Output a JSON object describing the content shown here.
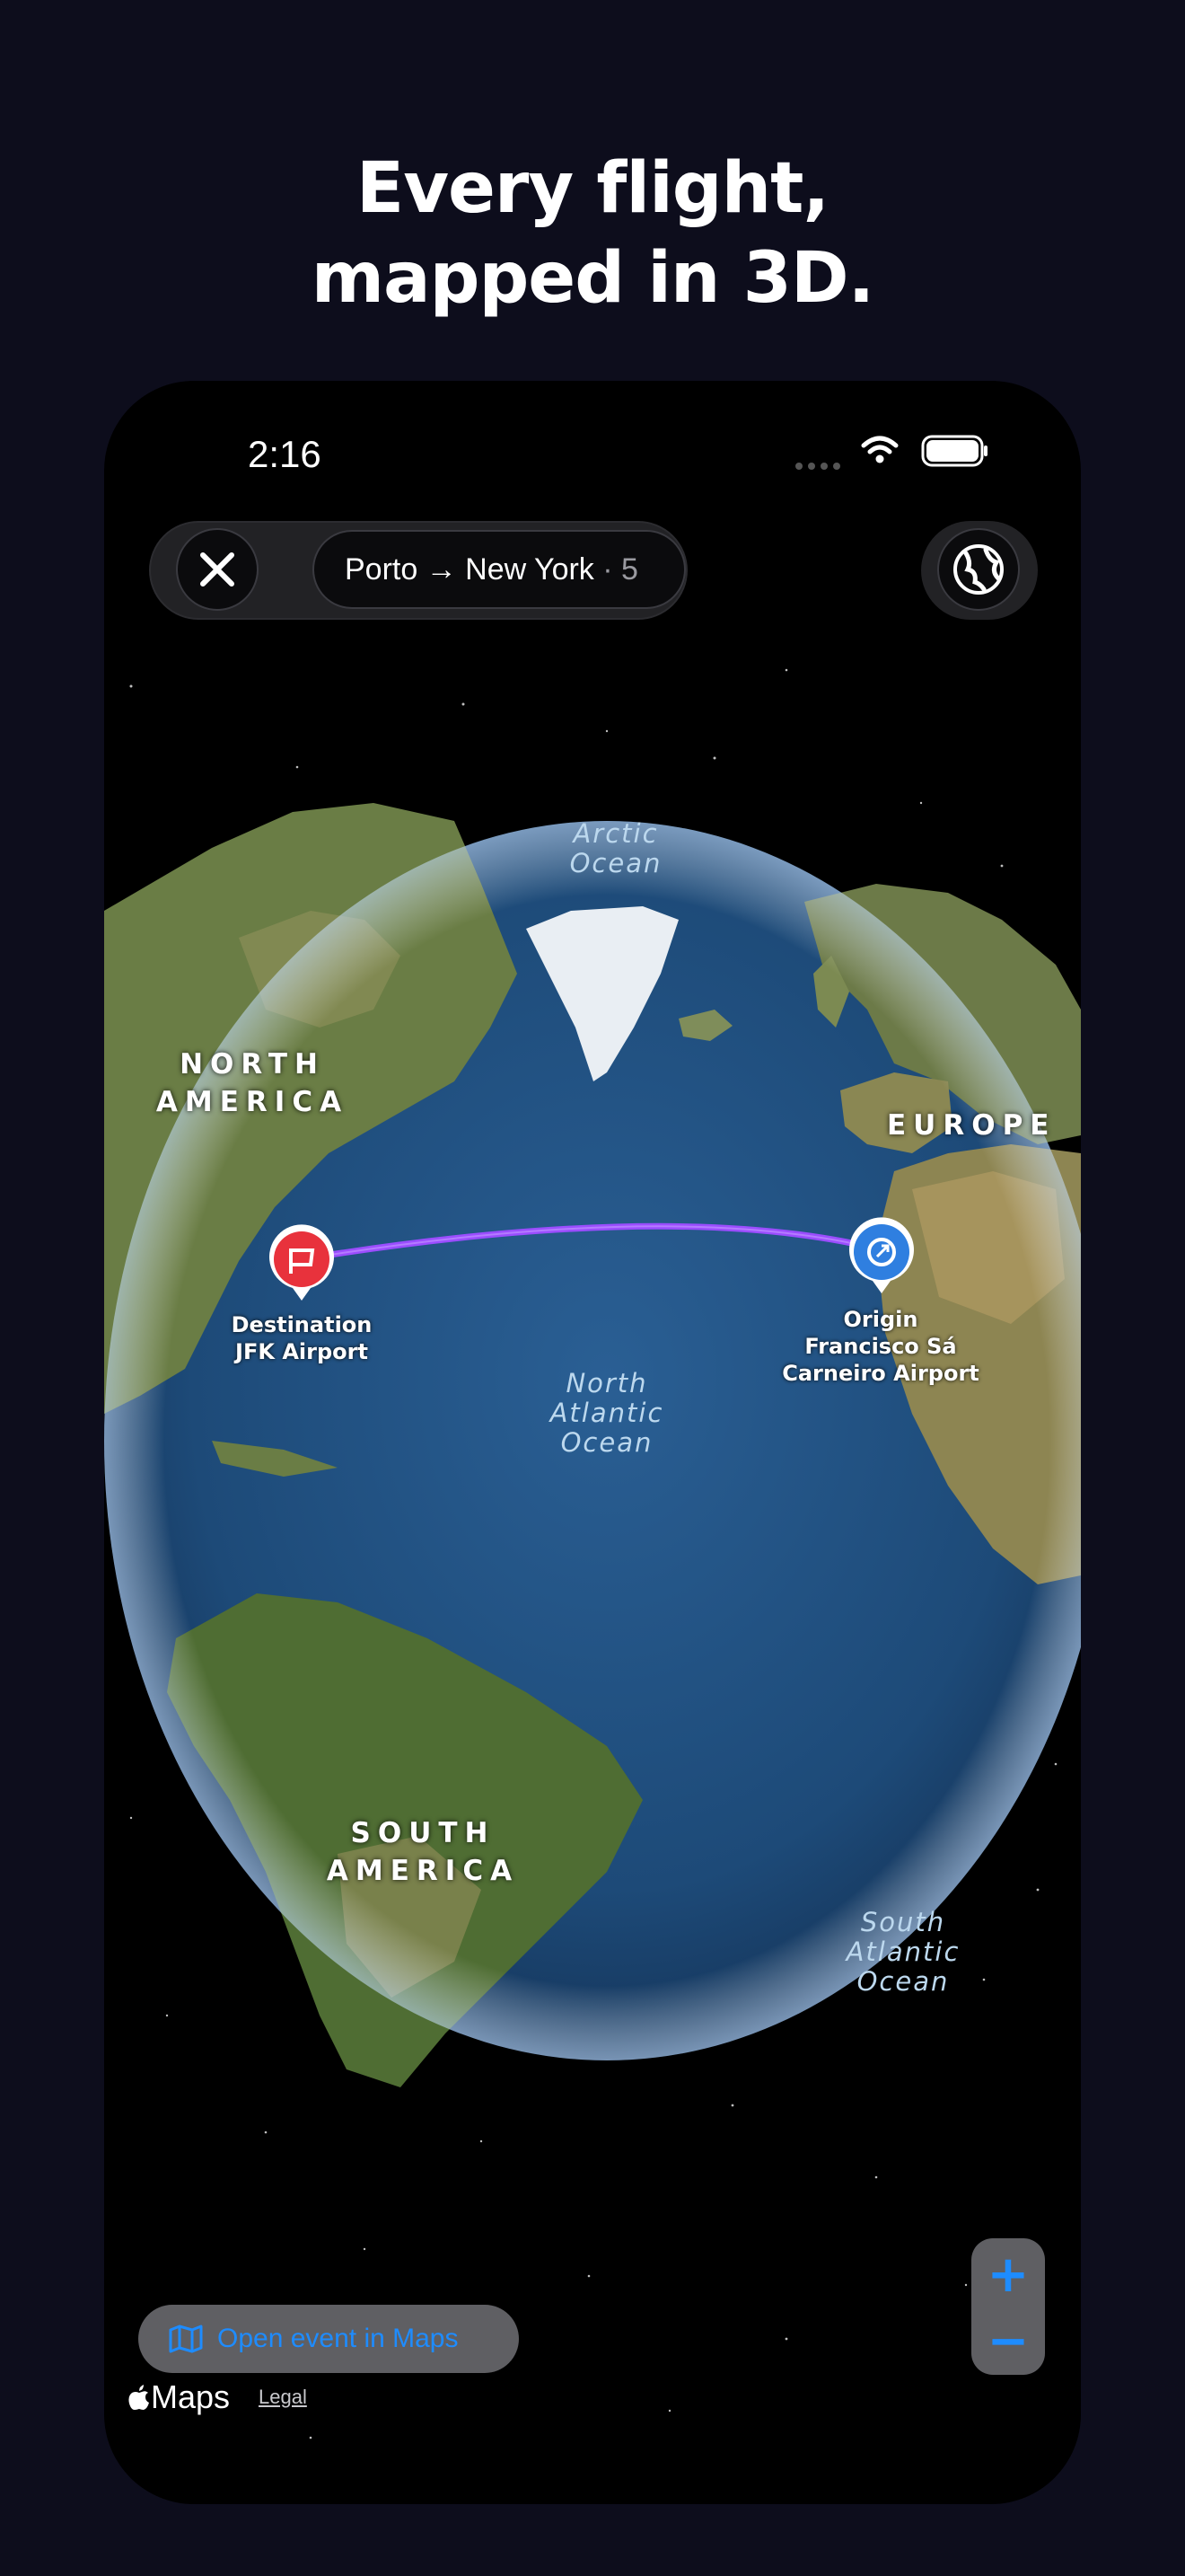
{
  "headline": {
    "line1": "Every flight,",
    "line2": "mapped in 3D."
  },
  "status": {
    "time": "2:16"
  },
  "top_bar": {
    "route": "Porto → New York",
    "separator": " · ",
    "count": "5"
  },
  "map": {
    "continents": {
      "north_america_1": "NORTH",
      "north_america_2": "AMERICA",
      "europe": "EUROPE",
      "south_america_1": "SOUTH",
      "south_america_2": "AMERICA"
    },
    "oceans": {
      "arctic_1": "Arctic",
      "arctic_2": "Ocean",
      "north_atlantic_1": "North",
      "north_atlantic_2": "Atlantic",
      "north_atlantic_3": "Ocean",
      "south_atlantic_1": "South",
      "south_atlantic_2": "Atlantic",
      "south_atlantic_3": "Ocean"
    },
    "destination": {
      "title": "Destination",
      "name": "JFK Airport",
      "color": "#e8323c"
    },
    "origin": {
      "title": "Origin",
      "name_1": "Francisco Sá",
      "name_2": "Carneiro Airport",
      "color": "#2f7fe0"
    },
    "route_color": "#9b4dff"
  },
  "controls": {
    "zoom_in": "+",
    "zoom_out": "−",
    "open_maps": "Open event in Maps",
    "maps_brand": "Maps",
    "legal": "Legal"
  }
}
